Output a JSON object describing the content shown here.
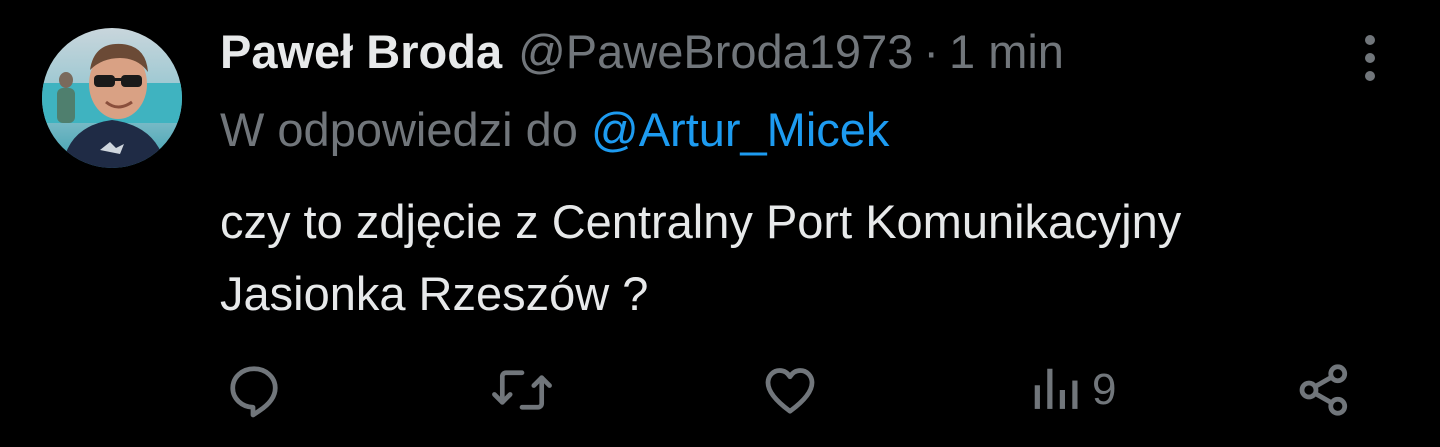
{
  "tweet": {
    "author": {
      "display_name": "Paweł Broda",
      "handle": "@PaweBroda1973",
      "avatar_icon": "profile-photo-man-sunglasses"
    },
    "time_separator": "·",
    "timestamp": "1 min",
    "reply_context": {
      "prefix": "W odpowiedzi do ",
      "mention": "@Artur_Micek"
    },
    "text_lines": [
      "czy to zdjęcie z Centralny Port Komunikacyjny",
      "Jasionka Rzeszów ?"
    ],
    "actions": {
      "reply_icon": "reply-icon",
      "retweet_icon": "retweet-icon",
      "like_icon": "heart-icon",
      "views_icon": "views-icon",
      "views_count": "9",
      "share_icon": "share-icon"
    },
    "more_icon": "more-vertical-icon"
  },
  "colors": {
    "background": "#000000",
    "primary_text": "#e7e9ea",
    "secondary_text": "#71767b",
    "accent": "#1d9bf0"
  }
}
